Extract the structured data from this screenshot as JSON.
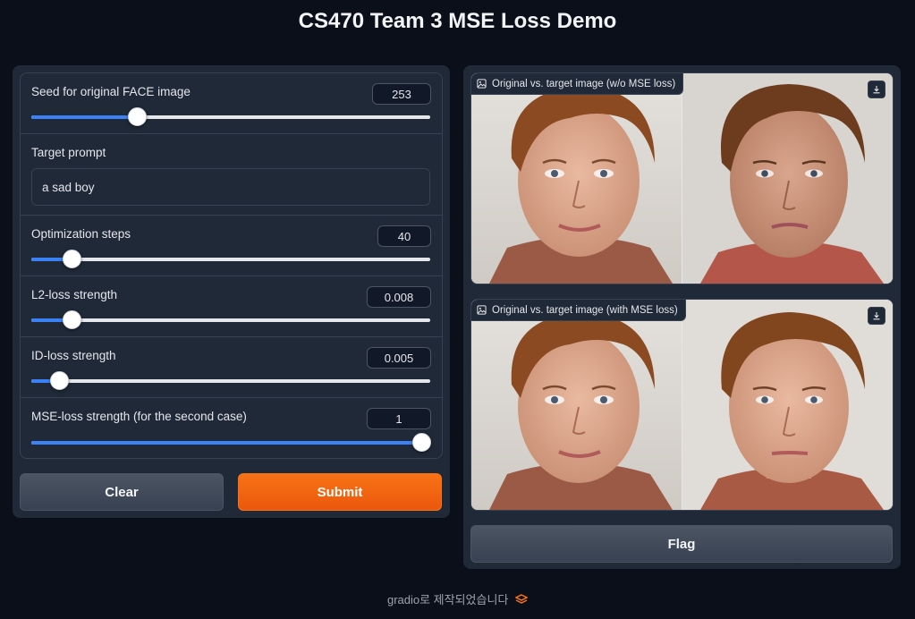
{
  "title": "CS470 Team 3 MSE Loss Demo",
  "inputs": {
    "seed": {
      "label": "Seed for original FACE image",
      "value": "253",
      "fraction": 0.265
    },
    "prompt": {
      "label": "Target prompt",
      "value": "a sad boy"
    },
    "steps": {
      "label": "Optimization steps",
      "value": "40",
      "fraction": 0.1
    },
    "l2": {
      "label": "L2-loss strength",
      "value": "0.008",
      "fraction": 0.1
    },
    "id": {
      "label": "ID-loss strength",
      "value": "0.005",
      "fraction": 0.07
    },
    "mse": {
      "label": "MSE-loss strength (for the second case)",
      "value": "1",
      "fraction": 0.978
    }
  },
  "buttons": {
    "clear": "Clear",
    "submit": "Submit",
    "flag": "Flag"
  },
  "outputs": {
    "without_mse": {
      "label": "Original vs. target image (w/o MSE loss)"
    },
    "with_mse": {
      "label": "Original vs. target image (with MSE loss)"
    }
  },
  "footer": {
    "text": "gradio로 제작되었습니다"
  },
  "colors": {
    "accent": "#3b82f6",
    "primary": "#f97316",
    "background": "#0b0f19"
  }
}
